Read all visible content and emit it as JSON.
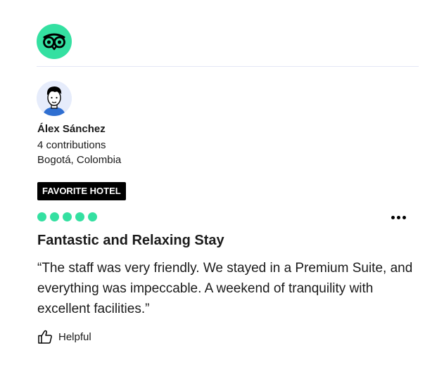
{
  "colors": {
    "brand": "#34e0a1",
    "rating": "#34e0a1",
    "badge_bg": "#000000",
    "divider": "#e3e6f5"
  },
  "header": {
    "logo_icon": "owl-logo-icon"
  },
  "reviewer": {
    "name": "Álex Sánchez",
    "contributions": "4 contributions",
    "location": "Bogotá, Colombia",
    "avatar_icon": "avatar-illustration-icon"
  },
  "review": {
    "badge": "FAVORITE HOTEL",
    "rating": 5,
    "rating_max": 5,
    "title": "Fantastic and Relaxing Stay",
    "text": "“The staff was very friendly. We stayed in a Premium Suite, and everything was impeccable. A weekend of tranquility with excellent facilities.”",
    "more_icon": "more-options-icon"
  },
  "actions": {
    "helpful_label": "Helpful",
    "helpful_icon": "thumbs-up-icon"
  }
}
